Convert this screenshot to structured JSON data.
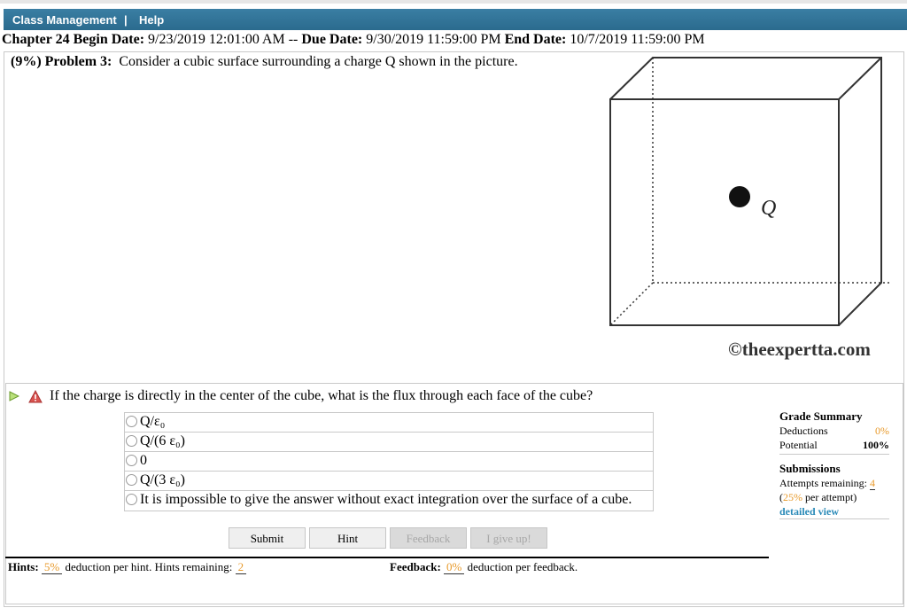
{
  "nav": {
    "class_management": "Class Management",
    "divider": "|",
    "help": "Help"
  },
  "header": {
    "chapter": "Chapter 24",
    "begin_label": "Begin Date:",
    "begin_value": "9/23/2019 12:01:00 AM",
    "dash": "--",
    "due_label": "Due Date:",
    "due_value": "9/30/2019 11:59:00 PM",
    "end_label": "End Date:",
    "end_value": "10/7/2019 11:59:00 PM"
  },
  "problem": {
    "weight": "(9%)",
    "label": "Problem 3:",
    "text": "Consider a cubic surface surrounding a charge Q shown in the picture."
  },
  "figure": {
    "charge_label": "Q",
    "credit": "©theexpertta.com"
  },
  "question": {
    "text": "If the charge is directly in the center of the cube, what is the flux through each face of the cube?",
    "choices": [
      "Q/ε₀",
      "Q/(6 ε₀)",
      "0",
      "Q/(3 ε₀)",
      "It is impossible to give the answer without exact integration over the surface of a cube."
    ]
  },
  "buttons": {
    "submit": "Submit",
    "hint": "Hint",
    "feedback": "Feedback",
    "give_up": "I give up!"
  },
  "hints": {
    "label": "Hints:",
    "percent": "5%",
    "mid": "deduction per hint. Hints remaining:",
    "remaining": "2"
  },
  "feedback": {
    "label": "Feedback:",
    "percent": "0%",
    "tail": "deduction per feedback."
  },
  "grade_summary": {
    "title": "Grade Summary",
    "deductions_label": "Deductions",
    "deductions_value": "0%",
    "potential_label": "Potential",
    "potential_value": "100%",
    "submissions_title": "Submissions",
    "attempts_label": "Attempts remaining:",
    "attempts_value": "4",
    "per_attempt_open": "(",
    "per_attempt_pct": "25%",
    "per_attempt_tail": "per attempt)",
    "detailed_view": "detailed view"
  },
  "colors": {
    "nav_bar": "#2b6b8e",
    "accent_orange": "#e89a2b",
    "link_blue": "#2a8ab8",
    "warn_red": "#d9534f",
    "play_green": "#8cc63f"
  },
  "icons": {
    "play": "play-triangle-icon",
    "warning": "warning-icon"
  }
}
